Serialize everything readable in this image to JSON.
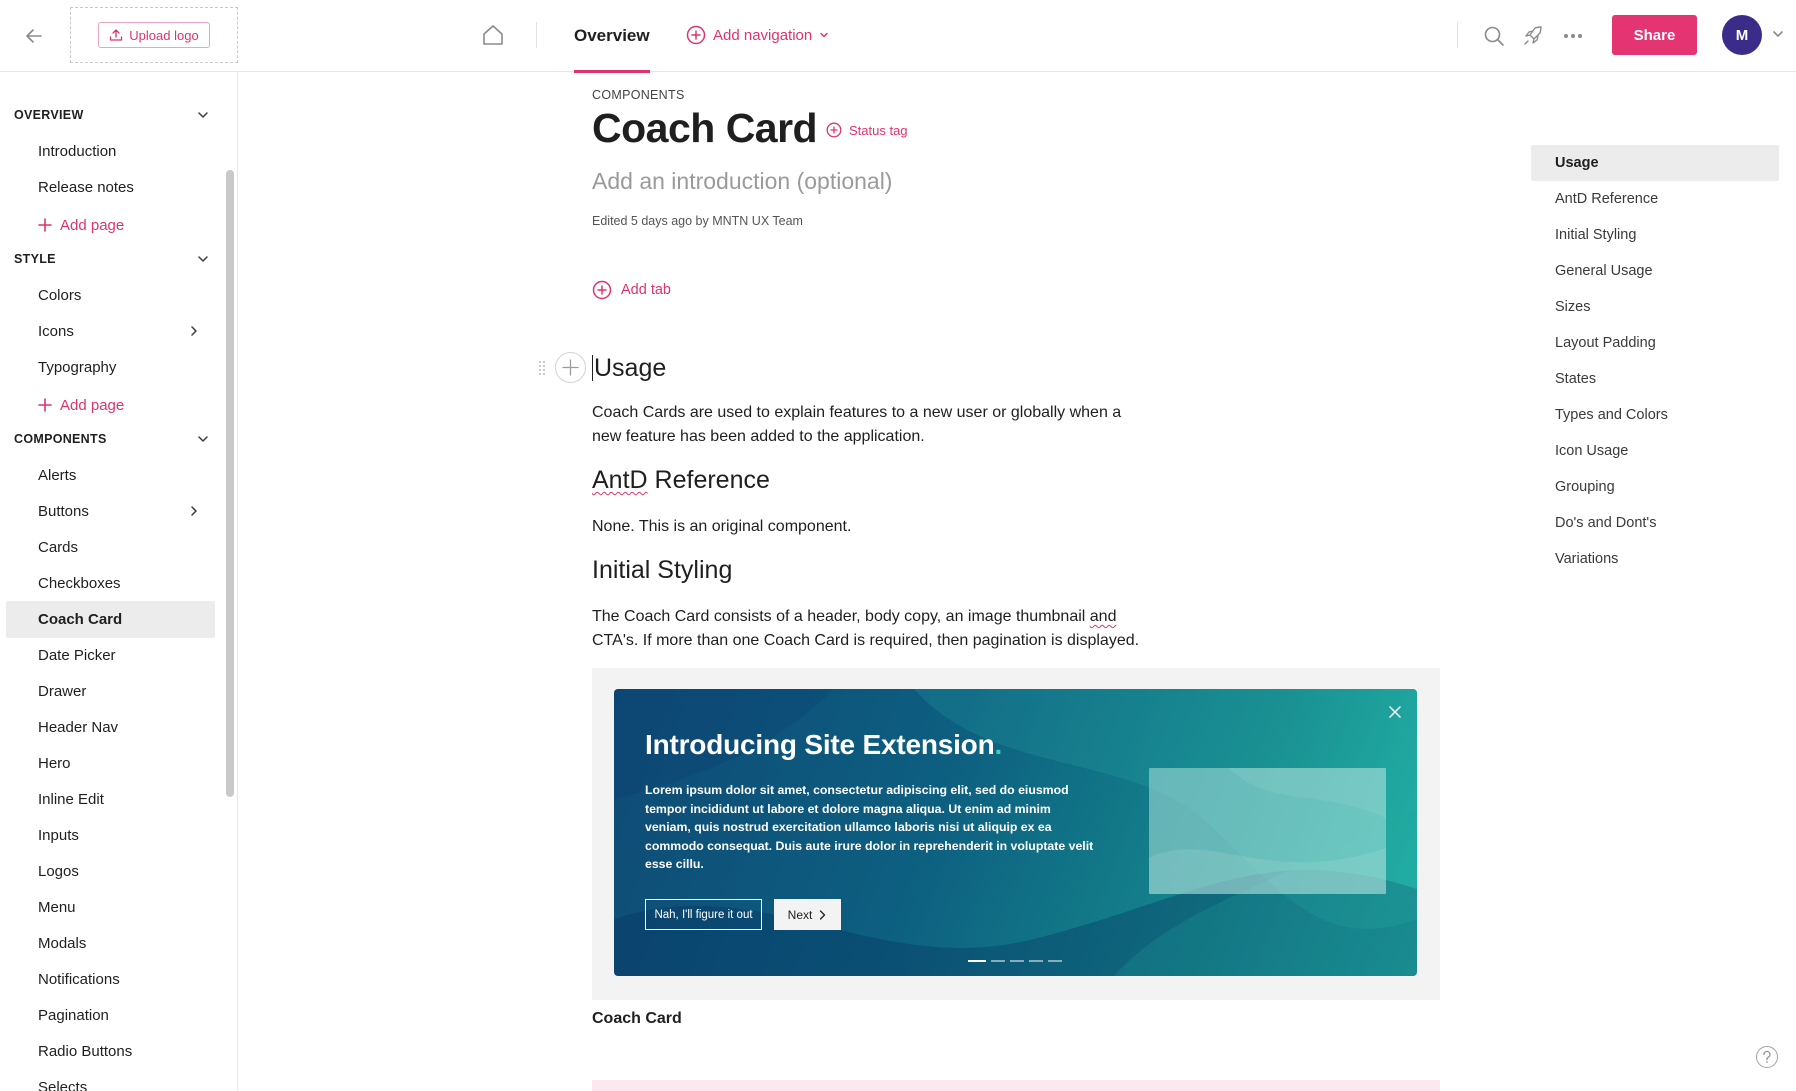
{
  "topbar": {
    "upload_logo_label": "Upload logo",
    "overview_tab": "Overview",
    "add_navigation_label": "Add navigation",
    "share_label": "Share",
    "avatar_initial": "M"
  },
  "sidebar": {
    "sections": [
      {
        "title": "OVERVIEW",
        "items": [
          "Introduction",
          "Release notes"
        ],
        "add_label": "Add page"
      },
      {
        "title": "STYLE",
        "items": [
          "Colors",
          "Icons",
          "Typography"
        ],
        "add_label": "Add page"
      },
      {
        "title": "COMPONENTS",
        "items": [
          "Alerts",
          "Buttons",
          "Cards",
          "Checkboxes",
          "Coach Card",
          "Date Picker",
          "Drawer",
          "Header Nav",
          "Hero",
          "Inline Edit",
          "Inputs",
          "Logos",
          "Menu",
          "Modals",
          "Notifications",
          "Pagination",
          "Radio Buttons",
          "Selects"
        ]
      }
    ],
    "active_item": "Coach Card"
  },
  "page": {
    "breadcrumb": "COMPONENTS",
    "title": "Coach Card",
    "status_tag_label": "Status tag",
    "intro_placeholder": "Add an introduction (optional)",
    "edited_meta": "Edited 5 days ago by MNTN UX Team",
    "add_tab_label": "Add tab",
    "sections": {
      "usage_heading": "Usage",
      "usage_text": "Coach Cards are used to explain features to a new user or globally when a new feature has been added to the application.",
      "antd_heading_a": "AntD",
      "antd_heading_b": " Reference",
      "antd_text": "None. This is an original component.",
      "styling_heading": "Initial Styling",
      "styling_text_a": "The Coach Card consists of a header, body copy, an image thumbnail ",
      "styling_text_and": "and",
      "styling_text_b": " CTA's. If more than one Coach Card is required, then pagination is displayed."
    },
    "figure": {
      "card_title": "Introducing Site Extension",
      "card_title_dot": ".",
      "card_body": "Lorem ipsum dolor sit amet, consectetur adipiscing elit, sed do eiusmod tempor incididunt ut labore et dolore magna aliqua. Ut enim ad minim veniam, quis nostrud exercitation ullamco laboris nisi ut aliquip ex ea commodo consequat. Duis aute irure dolor in reprehenderit in voluptate velit esse cillu.",
      "dismiss_label": "Nah, I'll figure it out",
      "next_label": "Next",
      "pagination_total": 5,
      "pagination_current": 1,
      "caption": "Coach Card"
    }
  },
  "toc": {
    "items": [
      "Usage",
      "AntD Reference",
      "Initial Styling",
      "General Usage",
      "Sizes",
      "Layout Padding",
      "States",
      "Types and Colors",
      "Icon Usage",
      "Grouping",
      "Do's and Dont's",
      "Variations"
    ],
    "active": "Usage"
  },
  "colors": {
    "accent": "#e0336e",
    "share_button": "#e53472",
    "avatar": "#3b2c8a",
    "card_gradient_start": "#0e4a75",
    "card_gradient_end": "#20b3a6"
  },
  "icons": [
    "arrow-left-icon",
    "upload-icon",
    "home-icon",
    "plus-circle-icon",
    "chevron-down-icon",
    "search-icon",
    "rocket-icon",
    "more-icon",
    "chevron-right-icon",
    "plus-icon",
    "close-icon",
    "help-icon",
    "drag-handle-icon"
  ]
}
